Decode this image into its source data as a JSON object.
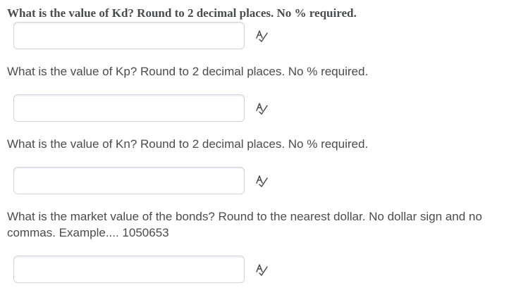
{
  "questions": [
    {
      "text": "What is the value of Kd?   Round to 2 decimal places.  No % required.",
      "answer_value": ""
    },
    {
      "text": "What is the value of Kp?   Round to 2 decimal places.  No % required.",
      "answer_value": ""
    },
    {
      "text": "What is the value of Kn?   Round to 2 decimal places.  No % required.",
      "answer_value": ""
    },
    {
      "text": "What is the market value of the bonds?   Round to the nearest dollar.   No dollar sign and no commas.   Example.... 1050653",
      "answer_value": ""
    }
  ],
  "icons": {
    "spellcheck": "spellcheck-icon"
  },
  "colors": {
    "text": "#494c4e",
    "input_border": "#cdd5dc",
    "icon": "#494c4e"
  }
}
